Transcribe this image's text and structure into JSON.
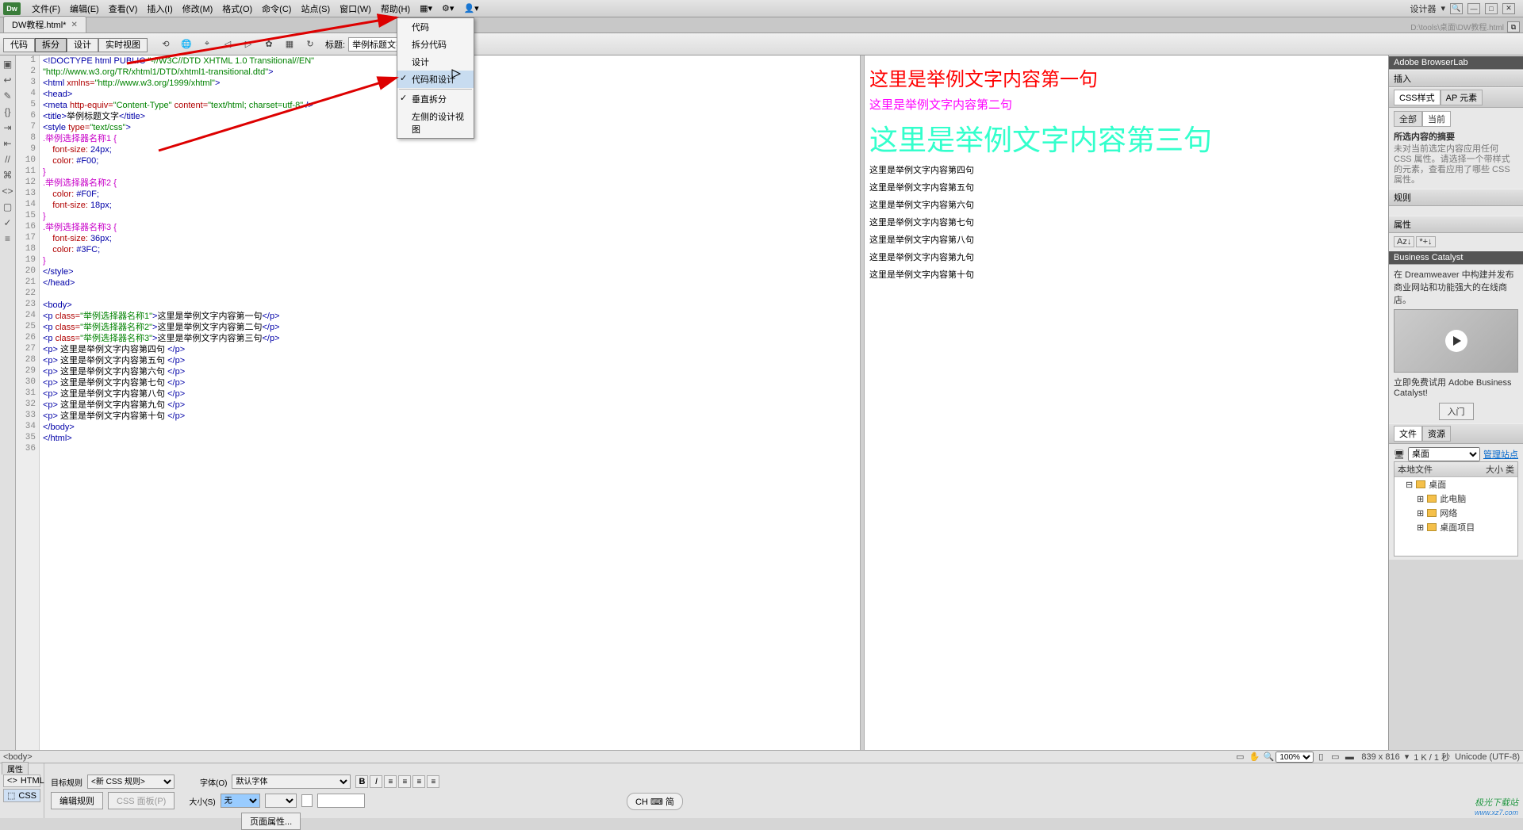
{
  "menubar": {
    "logo": "Dw",
    "items": [
      "文件(F)",
      "编辑(E)",
      "查看(V)",
      "插入(I)",
      "修改(M)",
      "格式(O)",
      "命令(C)",
      "站点(S)",
      "窗口(W)",
      "帮助(H)"
    ],
    "workspace": "设计器",
    "search_icon": "▾"
  },
  "tabbar": {
    "tab": "DW教程.html*",
    "path": "D:\\tools\\桌面\\DW教程.html"
  },
  "doctoolbar": {
    "buttons": [
      "代码",
      "拆分",
      "设计",
      "实时视图"
    ],
    "active": 1,
    "title_lbl": "标题:",
    "title_val": "举例标题文字"
  },
  "layout_menu": {
    "items": [
      "代码",
      "拆分代码",
      "设计",
      "代码和设计",
      "垂直拆分",
      "左侧的设计视图"
    ],
    "checked": [
      3,
      4
    ]
  },
  "code_lines": [
    {
      "n": 1,
      "html": "<span class='t-tag'>&lt;!DOCTYPE html PUBLIC </span><span class='t-str'>\"-//W3C//DTD XHTML 1.0 Transitional//EN\"</span>"
    },
    {
      "n": 2,
      "html": "<span class='t-str'>\"http://www.w3.org/TR/xhtml1/DTD/xhtml1-transitional.dtd\"</span><span class='t-tag'>&gt;</span>"
    },
    {
      "n": 3,
      "html": "<span class='t-tag'>&lt;html</span> <span class='t-attr'>xmlns=</span><span class='t-str'>\"http://www.w3.org/1999/xhtml\"</span><span class='t-tag'>&gt;</span>"
    },
    {
      "n": 4,
      "html": "<span class='t-tag'>&lt;head&gt;</span>"
    },
    {
      "n": 5,
      "html": "<span class='t-tag'>&lt;meta</span> <span class='t-attr'>http-equiv=</span><span class='t-str'>\"Content-Type\"</span> <span class='t-attr'>content=</span><span class='t-str'>\"text/html; charset=utf-8\"</span> <span class='t-tag'>/&gt;</span>"
    },
    {
      "n": 6,
      "html": "<span class='t-tag'>&lt;title&gt;</span>举例标题文字<span class='t-tag'>&lt;/title&gt;</span>"
    },
    {
      "n": 7,
      "html": "<span class='t-tag'>&lt;style</span> <span class='t-attr'>type=</span><span class='t-str'>\"text/css\"</span><span class='t-tag'>&gt;</span>"
    },
    {
      "n": 8,
      "html": "<span class='t-sel'>.举例选择器名称1 {</span>"
    },
    {
      "n": 9,
      "html": "    <span class='t-attr'>font-size:</span> <span class='t-tag'>24px;</span>"
    },
    {
      "n": 10,
      "html": "    <span class='t-attr'>color:</span> <span class='t-tag'>#F00;</span>"
    },
    {
      "n": 11,
      "html": "<span class='t-sel'>}</span>"
    },
    {
      "n": 12,
      "html": "<span class='t-sel'>.举例选择器名称2 {</span>"
    },
    {
      "n": 13,
      "html": "    <span class='t-attr'>color:</span> <span class='t-tag'>#F0F;</span>"
    },
    {
      "n": 14,
      "html": "    <span class='t-attr'>font-size:</span> <span class='t-tag'>18px;</span>"
    },
    {
      "n": 15,
      "html": "<span class='t-sel'>}</span>"
    },
    {
      "n": 16,
      "html": "<span class='t-sel'>.举例选择器名称3 {</span>"
    },
    {
      "n": 17,
      "html": "    <span class='t-attr'>font-size:</span> <span class='t-tag'>36px;</span>"
    },
    {
      "n": 18,
      "html": "    <span class='t-attr'>color:</span> <span class='t-tag'>#3FC;</span>"
    },
    {
      "n": 19,
      "html": "<span class='t-sel'>}</span>"
    },
    {
      "n": 20,
      "html": "<span class='t-tag'>&lt;/style&gt;</span>"
    },
    {
      "n": 21,
      "html": "<span class='t-tag'>&lt;/head&gt;</span>"
    },
    {
      "n": 22,
      "html": ""
    },
    {
      "n": 23,
      "html": "<span class='t-tag'>&lt;body&gt;</span>"
    },
    {
      "n": 24,
      "html": "<span class='t-tag'>&lt;p</span> <span class='t-attr'>class=</span><span class='t-str'>\"举例选择器名称1\"</span><span class='t-tag'>&gt;</span>这里是举例文字内容第一句<span class='t-tag'>&lt;/p&gt;</span>"
    },
    {
      "n": 25,
      "html": "<span class='t-tag'>&lt;p</span> <span class='t-attr'>class=</span><span class='t-str'>\"举例选择器名称2\"</span><span class='t-tag'>&gt;</span>这里是举例文字内容第二句<span class='t-tag'>&lt;/p&gt;</span>"
    },
    {
      "n": 26,
      "html": "<span class='t-tag'>&lt;p</span> <span class='t-attr'>class=</span><span class='t-str'>\"举例选择器名称3\"</span><span class='t-tag'>&gt;</span>这里是举例文字内容第三句<span class='t-tag'>&lt;/p&gt;</span>"
    },
    {
      "n": 27,
      "html": "<span class='t-tag'>&lt;p&gt;</span> 这里是举例文字内容第四句 <span class='t-tag'>&lt;/p&gt;</span>"
    },
    {
      "n": 28,
      "html": "<span class='t-tag'>&lt;p&gt;</span> 这里是举例文字内容第五句 <span class='t-tag'>&lt;/p&gt;</span>"
    },
    {
      "n": 29,
      "html": "<span class='t-tag'>&lt;p&gt;</span> 这里是举例文字内容第六句 <span class='t-tag'>&lt;/p&gt;</span>"
    },
    {
      "n": 30,
      "html": "<span class='t-tag'>&lt;p&gt;</span> 这里是举例文字内容第七句 <span class='t-tag'>&lt;/p&gt;</span>"
    },
    {
      "n": 31,
      "html": "<span class='t-tag'>&lt;p&gt;</span> 这里是举例文字内容第八句 <span class='t-tag'>&lt;/p&gt;</span>"
    },
    {
      "n": 32,
      "html": "<span class='t-tag'>&lt;p&gt;</span> 这里是举例文字内容第九句 <span class='t-tag'>&lt;/p&gt;</span>"
    },
    {
      "n": 33,
      "html": "<span class='t-tag'>&lt;p&gt;</span> 这里是举例文字内容第十句 <span class='t-tag'>&lt;/p&gt;</span>"
    },
    {
      "n": 34,
      "html": "<span class='t-tag'>&lt;/body&gt;</span>"
    },
    {
      "n": 35,
      "html": "<span class='t-tag'>&lt;/html&gt;</span>"
    },
    {
      "n": 36,
      "html": ""
    }
  ],
  "design_paras": [
    {
      "cls": "s1",
      "txt": "这里是举例文字内容第一句"
    },
    {
      "cls": "s2",
      "txt": "这里是举例文字内容第二句"
    },
    {
      "cls": "s3",
      "txt": "这里是举例文字内容第三句"
    },
    {
      "cls": "",
      "txt": "这里是举例文字内容第四句"
    },
    {
      "cls": "",
      "txt": "这里是举例文字内容第五句"
    },
    {
      "cls": "",
      "txt": "这里是举例文字内容第六句"
    },
    {
      "cls": "",
      "txt": "这里是举例文字内容第七句"
    },
    {
      "cls": "",
      "txt": "这里是举例文字内容第八句"
    },
    {
      "cls": "",
      "txt": "这里是举例文字内容第九句"
    },
    {
      "cls": "",
      "txt": "这里是举例文字内容第十句"
    }
  ],
  "right": {
    "browserlab": "Adobe BrowserLab",
    "insert": "插入",
    "css_tab1": "CSS样式",
    "css_tab2": "AP 元素",
    "css_all": "全部",
    "css_cur": "当前",
    "css_sel_hdr": "所选内容的摘要",
    "css_msg": "未对当前选定内容应用任何 CSS 属性。请选择一个带样式的元素，查看应用了哪些 CSS 属性。",
    "rules": "规则",
    "props": "属性",
    "bc_hdr": "Business Catalyst",
    "bc_msg": "在 Dreamweaver 中构建并发布商业网站和功能强大的在线商店。",
    "bc_try": "立即免费试用 Adobe Business Catalyst!",
    "bc_btn": "入门",
    "files_tab1": "文件",
    "files_tab2": "资源",
    "site_sel": "桌面",
    "manage": "管理站点",
    "fh_left": "本地文件",
    "fh_right": "大小 类",
    "tree": [
      "桌面",
      "此电脑",
      "网络",
      "桌面项目"
    ]
  },
  "status": {
    "tagpath": "<body>",
    "zoom": "100%",
    "dims": "839 x 816",
    "size": "1 K / 1 秒",
    "enc": "Unicode (UTF-8)"
  },
  "propsPanel": {
    "hdr": "属性",
    "html_btn": "HTML",
    "css_btn": "CSS",
    "target_rule_lbl": "目标规则",
    "target_rule_val": "<新 CSS 规则>",
    "edit_rule": "编辑规则",
    "css_panel": "CSS 面板(P)",
    "font_lbl": "字体(O)",
    "font_val": "默认字体",
    "size_lbl": "大小(S)",
    "size_val": "无",
    "page_props": "页面属性..."
  },
  "ime": "CH ⌨ 简",
  "watermark": {
    "t": "极光下载站",
    "u": "www.xz7.com"
  }
}
